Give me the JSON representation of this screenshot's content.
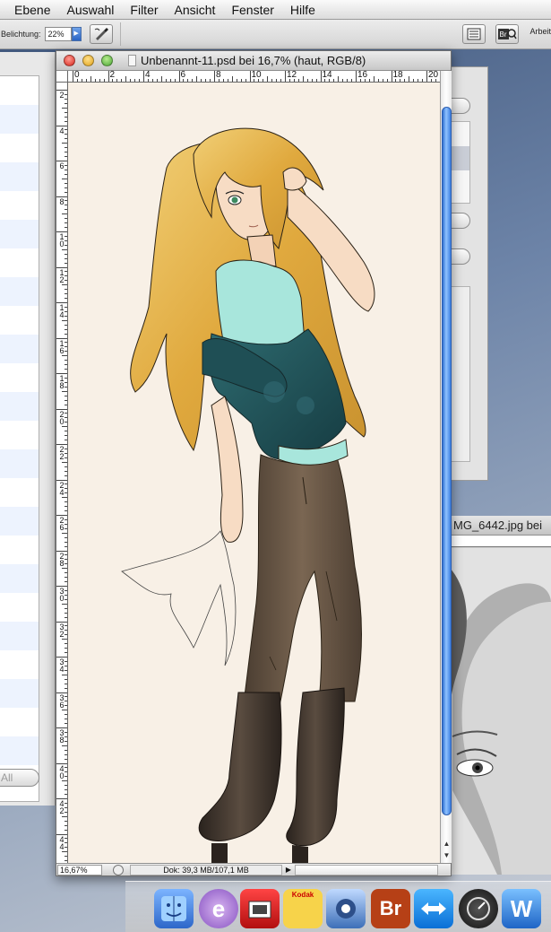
{
  "menubar": {
    "items": [
      "Ebene",
      "Auswahl",
      "Filter",
      "Ansicht",
      "Fenster",
      "Hilfe"
    ]
  },
  "options_bar": {
    "exposure_label": "Belichtung:",
    "exposure_value": "22%",
    "workspace_label": "Arbeit"
  },
  "left_palette": {
    "all_button": "All"
  },
  "document": {
    "title": "Unbenannt-11.psd bei 16,7% (haut, RGB/8)",
    "ruler_h": [
      "0",
      "2",
      "4",
      "6",
      "8",
      "10",
      "12",
      "14",
      "16",
      "18",
      "20"
    ],
    "ruler_v": [
      "2",
      "4",
      "6",
      "8",
      "10",
      "12",
      "14",
      "16",
      "18",
      "20",
      "22",
      "24",
      "26",
      "28",
      "30",
      "32",
      "34",
      "36",
      "38",
      "40",
      "42",
      "44"
    ],
    "status": {
      "zoom": "16,67%",
      "doc_info": "Dok: 39,3 MB/107,1 MB"
    }
  },
  "photo_window": {
    "title": "MG_6442.jpg bei"
  },
  "dock": {
    "items": [
      "finder-icon",
      "ecto-icon",
      "photo-booth-icon",
      "kodak-icon",
      "preview-icon",
      "bridge-icon",
      "teamviewer-icon",
      "dashboard-icon",
      "word-icon"
    ],
    "bridge_label": "Br",
    "kodak_label": "Kodak"
  },
  "colors": {
    "canvas": "#f8f0e6",
    "hair": "#e3b14a",
    "top": "#1f4f55",
    "tank": "#a8e6dc",
    "jeans": "#5f4e3e",
    "boots": "#3a312a"
  }
}
